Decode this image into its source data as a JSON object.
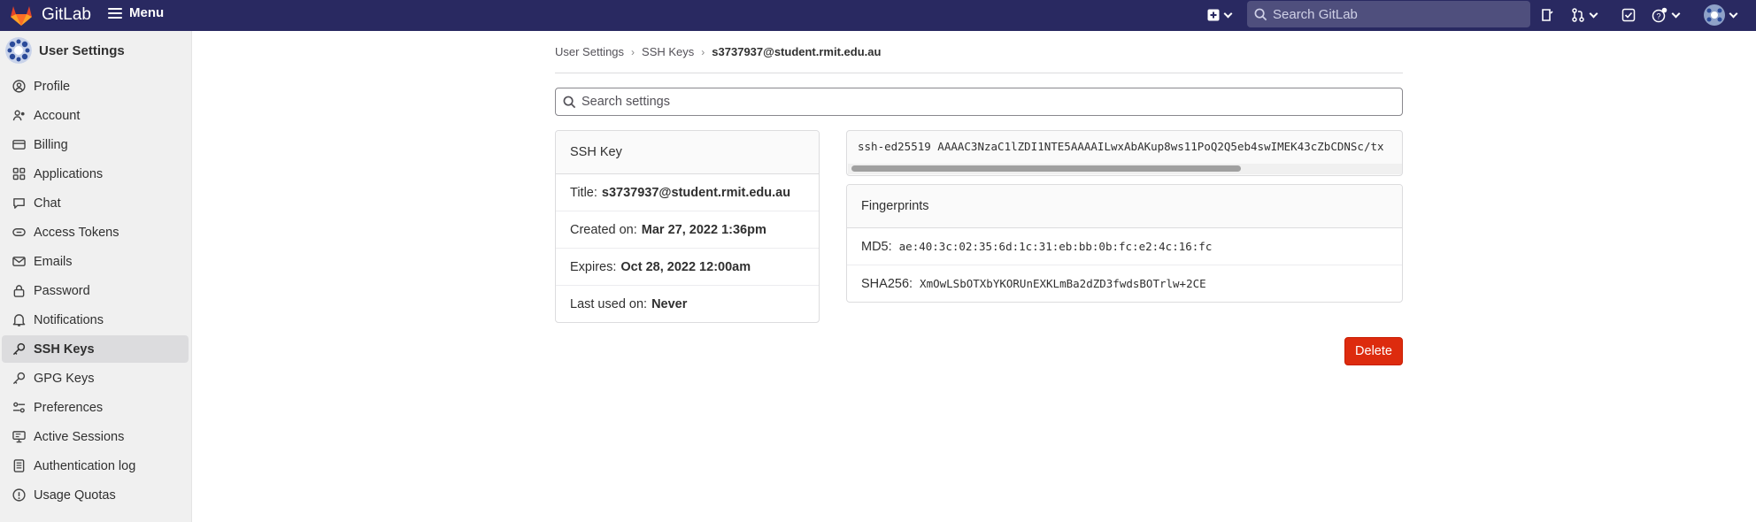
{
  "topbar": {
    "brand": "GitLab",
    "menu_label": "Menu",
    "search_placeholder": "Search GitLab"
  },
  "sidebar": {
    "title": "User Settings",
    "items": [
      {
        "label": "Profile",
        "icon": "profile-icon"
      },
      {
        "label": "Account",
        "icon": "account-icon"
      },
      {
        "label": "Billing",
        "icon": "billing-icon"
      },
      {
        "label": "Applications",
        "icon": "applications-icon"
      },
      {
        "label": "Chat",
        "icon": "chat-icon"
      },
      {
        "label": "Access Tokens",
        "icon": "token-icon"
      },
      {
        "label": "Emails",
        "icon": "mail-icon"
      },
      {
        "label": "Password",
        "icon": "lock-icon"
      },
      {
        "label": "Notifications",
        "icon": "bell-icon"
      },
      {
        "label": "SSH Keys",
        "icon": "key-icon",
        "active": true
      },
      {
        "label": "GPG Keys",
        "icon": "key-icon"
      },
      {
        "label": "Preferences",
        "icon": "preferences-icon"
      },
      {
        "label": "Active Sessions",
        "icon": "monitor-icon"
      },
      {
        "label": "Authentication log",
        "icon": "log-icon"
      },
      {
        "label": "Usage Quotas",
        "icon": "quota-icon"
      }
    ]
  },
  "breadcrumb": [
    "User Settings",
    "SSH Keys",
    "s3737937@student.rmit.edu.au"
  ],
  "search": {
    "placeholder": "Search settings"
  },
  "ssh_key_card": {
    "header": "SSH Key",
    "title_label": "Title:",
    "title_value": "s3737937@student.rmit.edu.au",
    "created_label": "Created on:",
    "created_value": "Mar 27, 2022 1:36pm",
    "expires_label": "Expires:",
    "expires_value": "Oct 28, 2022 12:00am",
    "last_used_label": "Last used on:",
    "last_used_value": "Never"
  },
  "key_text": "ssh-ed25519 AAAAC3NzaC1lZDI1NTE5AAAAILwxAbAKup8ws11PoQ2Q5eb4swIMEK43cZbCDNSc/tx",
  "fingerprints": {
    "header": "Fingerprints",
    "md5_label": "MD5:",
    "md5_value": "ae:40:3c:02:35:6d:1c:31:eb:bb:0b:fc:e2:4c:16:fc",
    "sha256_label": "SHA256:",
    "sha256_value": "XmOwLSbOTXbYKORUnEXKLmBa2dZD3fwdsBOTrlw+2CE"
  },
  "delete_label": "Delete",
  "colors": {
    "topbar": "#292961",
    "danger": "#dd2b0e",
    "logo": "#e24329"
  }
}
